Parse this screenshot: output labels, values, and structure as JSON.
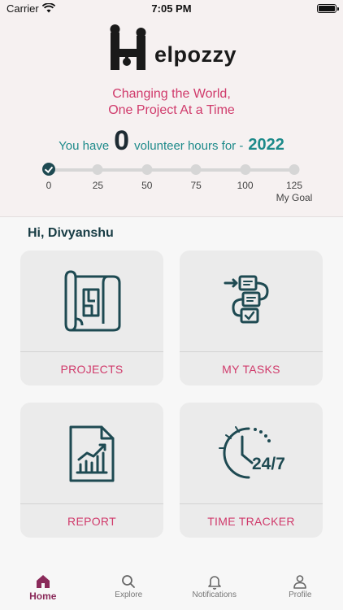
{
  "status_bar": {
    "carrier": "Carrier",
    "time": "7:05 PM"
  },
  "app": {
    "logo_text": "elpozzy",
    "logo_letter_icon": "H-circuit-logo"
  },
  "header": {
    "tagline_line1": "Changing the World,",
    "tagline_line2": "One Project At a Time",
    "hours_prefix": "You have",
    "hours_value": "0",
    "hours_suffix": "volunteer hours for -",
    "year": "2022"
  },
  "progress": {
    "current": 0,
    "ticks": [
      "0",
      "25",
      "50",
      "75",
      "100",
      "125"
    ],
    "goal_label": "My Goal",
    "accent": "#1e4a52"
  },
  "greeting": "Hi, Divyanshu",
  "cards": [
    {
      "label": "PROJECTS",
      "icon": "blueprint-icon"
    },
    {
      "label": "MY TASKS",
      "icon": "task-flow-icon"
    },
    {
      "label": "REPORT",
      "icon": "report-chart-icon"
    },
    {
      "label": "TIME TRACKER",
      "icon": "clock-24-7-icon"
    }
  ],
  "tabs": [
    {
      "label": "Home",
      "icon": "home-icon",
      "active": true
    },
    {
      "label": "Explore",
      "icon": "search-icon",
      "active": false
    },
    {
      "label": "Notifications",
      "icon": "bell-icon",
      "active": false
    },
    {
      "label": "Profile",
      "icon": "person-icon",
      "active": false
    }
  ],
  "colors": {
    "accent_pink": "#d03a6b",
    "teal": "#1d8a8a",
    "dark_teal": "#1e4a52",
    "tab_active": "#8a2a5a"
  }
}
